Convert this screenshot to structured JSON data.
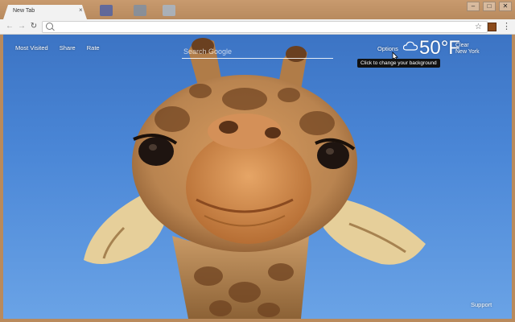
{
  "window": {
    "tab_title": "New Tab",
    "tab_close": "×",
    "controls": {
      "minimize": "–",
      "maximize": "□",
      "close": "✕"
    }
  },
  "toolbar": {
    "back_icon": "←",
    "forward_icon": "→",
    "reload_icon": "↻",
    "star_icon": "☆",
    "menu_icon": "⋮",
    "url": ""
  },
  "newtab": {
    "links": [
      "Most Visited",
      "Share",
      "Rate"
    ],
    "search_placeholder": "Search Google",
    "options_label": "Options",
    "tooltip": "Click to change your background",
    "weather": {
      "temperature": "50°F",
      "condition": "Clear",
      "location": "New York",
      "icon": "cloud-icon"
    },
    "support_label": "Support",
    "background": "giraffe close-up against blue sky"
  },
  "colors": {
    "sky_top": "#3c74c4",
    "sky_bottom": "#6aa3e6",
    "chrome": "#f2f2f2",
    "tooltip_bg": "#111111"
  }
}
